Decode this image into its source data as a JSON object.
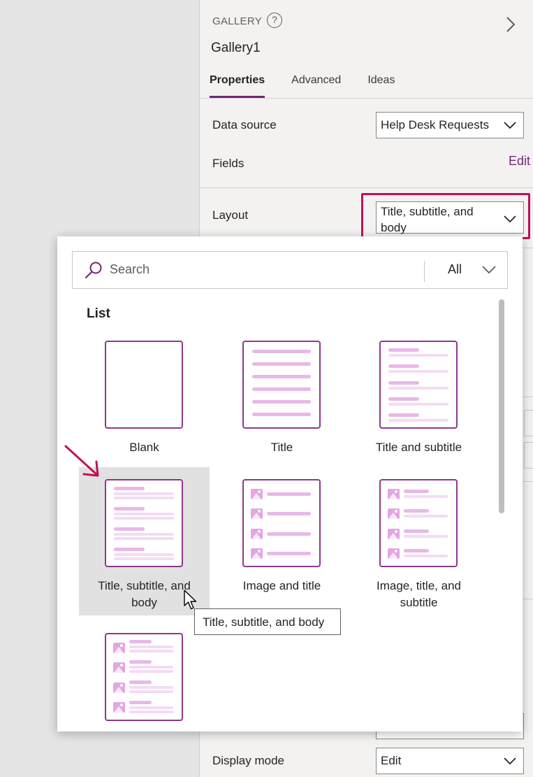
{
  "pane": {
    "control_type": "GALLERY",
    "help_icon": "?",
    "control_name": "Gallery1",
    "tabs": [
      {
        "label": "Properties",
        "active": true
      },
      {
        "label": "Advanced",
        "active": false
      },
      {
        "label": "Ideas",
        "active": false
      }
    ],
    "data_source": {
      "label": "Data source",
      "value": "Help Desk Requests"
    },
    "fields": {
      "label": "Fields",
      "action": "Edit"
    },
    "layout": {
      "label": "Layout",
      "value": "Title, subtitle, and body"
    },
    "display_mode": {
      "label": "Display mode",
      "value": "Edit"
    }
  },
  "flyout": {
    "search_placeholder": "Search",
    "filter_value": "All",
    "section_title": "List",
    "layouts": [
      {
        "label": "Blank",
        "icon": "layout-blank-icon"
      },
      {
        "label": "Title",
        "icon": "layout-title-icon"
      },
      {
        "label": "Title and subtitle",
        "icon": "layout-title-subtitle-icon"
      },
      {
        "label": "Title, subtitle, and body",
        "icon": "layout-title-subtitle-body-icon",
        "selected": true
      },
      {
        "label": "Image and title",
        "icon": "layout-image-title-icon"
      },
      {
        "label": "Image, title, and subtitle",
        "icon": "layout-image-title-subtitle-icon"
      },
      {
        "label": "",
        "icon": "layout-image-title-subtitle-body-icon"
      }
    ]
  },
  "tooltip": "Title, subtitle, and body",
  "colors": {
    "accent": "#742774",
    "highlight": "#c0105a",
    "thumb_border": "#8b3a8b",
    "placeholder_dark": "#e8b8e8",
    "placeholder_light": "#f3dcf3"
  }
}
